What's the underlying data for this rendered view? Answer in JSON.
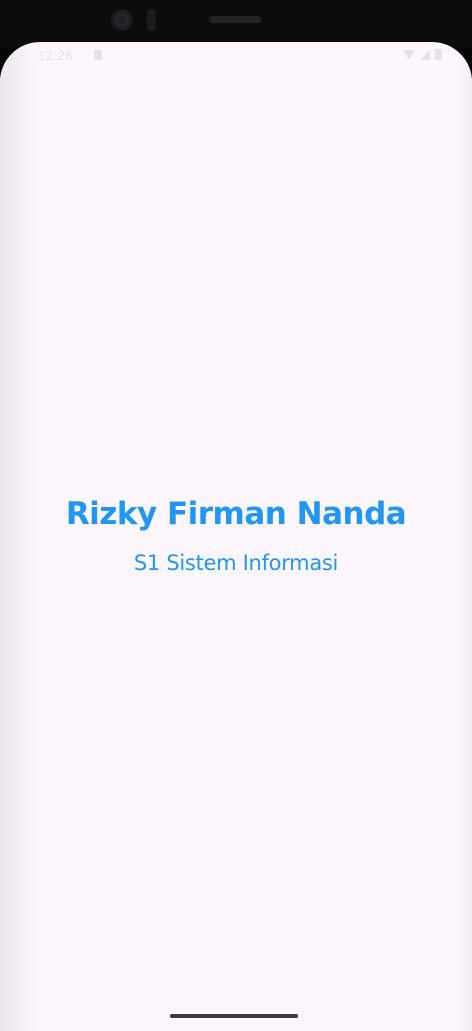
{
  "status_bar": {
    "time": "12:28",
    "icons": [
      "notification-icon",
      "wifi-icon",
      "signal-icon",
      "battery-icon"
    ]
  },
  "profile": {
    "name": "Rizky Firman Nanda",
    "major": "S1 Sistem Informasi"
  },
  "colors": {
    "accent": "#2196f3",
    "background": "#fdf7fd"
  }
}
